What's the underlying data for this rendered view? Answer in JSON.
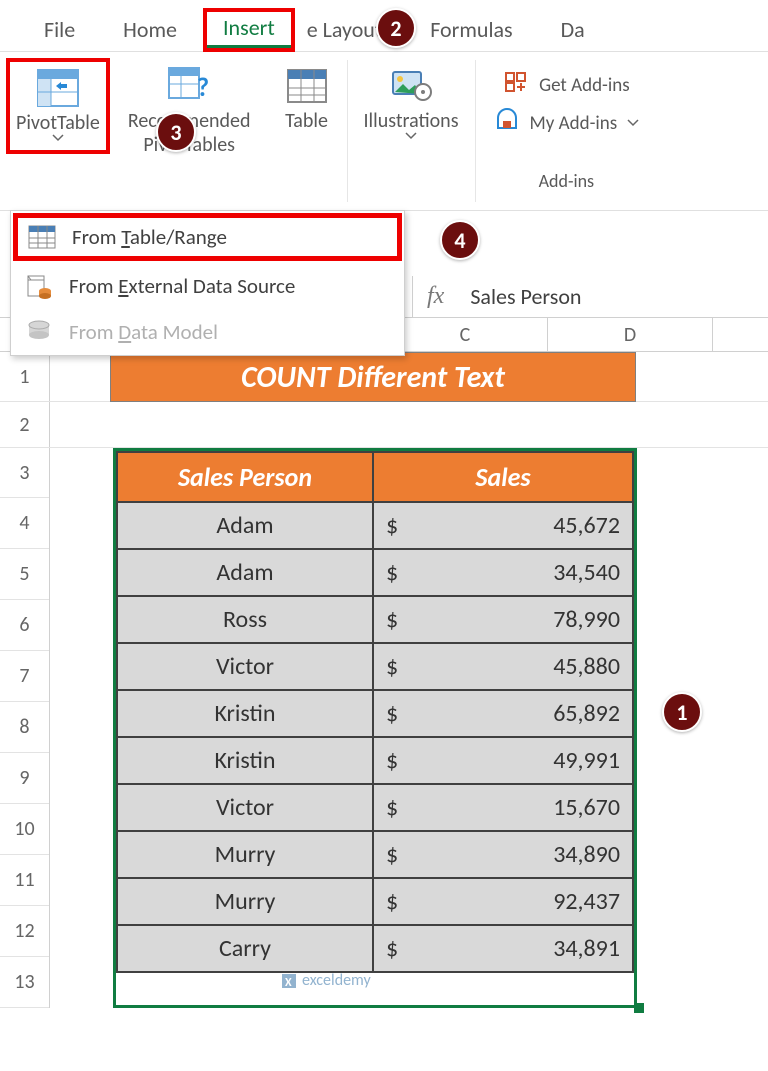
{
  "ribbon_tabs": {
    "file": "File",
    "home": "Home",
    "insert": "Insert",
    "page_layout_fragment": "e Layout",
    "formulas": "Formulas",
    "data_fragment": "Da"
  },
  "ribbon": {
    "pivottable": "PivotTable",
    "recommended": "Recommended\nPivotTables",
    "rec_line1": "Recommended",
    "rec_line2": "PivotTables",
    "table": "Table",
    "illustrations": "Illustrations",
    "get_addins": "Get Add-ins",
    "my_addins": "My Add-ins",
    "addins_label": "Add-ins"
  },
  "dropdown": {
    "from_table_pre": "From ",
    "from_table_u": "T",
    "from_table_post": "able/Range",
    "from_ext_pre": "From ",
    "from_ext_u": "E",
    "from_ext_post": "xternal Data Source",
    "from_dm_pre": "From ",
    "from_dm_u": "D",
    "from_dm_post": "ata Model"
  },
  "formula_bar": {
    "fx": "fx",
    "value": "Sales Person"
  },
  "col_headers": {
    "c": "C",
    "d": "D"
  },
  "row_nums": [
    "1",
    "2",
    "3",
    "4",
    "5",
    "6",
    "7",
    "8",
    "9",
    "10",
    "11",
    "12",
    "13"
  ],
  "banner": "COUNT Different Text",
  "table": {
    "h1": "Sales Person",
    "h2": "Sales",
    "rows": [
      {
        "name": "Adam",
        "sales": "45,672"
      },
      {
        "name": "Adam",
        "sales": "34,540"
      },
      {
        "name": "Ross",
        "sales": "78,990"
      },
      {
        "name": "Victor",
        "sales": "45,880"
      },
      {
        "name": "Kristin",
        "sales": "65,892"
      },
      {
        "name": "Kristin",
        "sales": "49,991"
      },
      {
        "name": "Victor",
        "sales": "15,670"
      },
      {
        "name": "Murry",
        "sales": "34,890"
      },
      {
        "name": "Murry",
        "sales": "92,437"
      },
      {
        "name": "Carry",
        "sales": "34,891"
      }
    ]
  },
  "badges": {
    "b1": "1",
    "b2": "2",
    "b3": "3",
    "b4": "4"
  },
  "watermark": "exceldemy"
}
